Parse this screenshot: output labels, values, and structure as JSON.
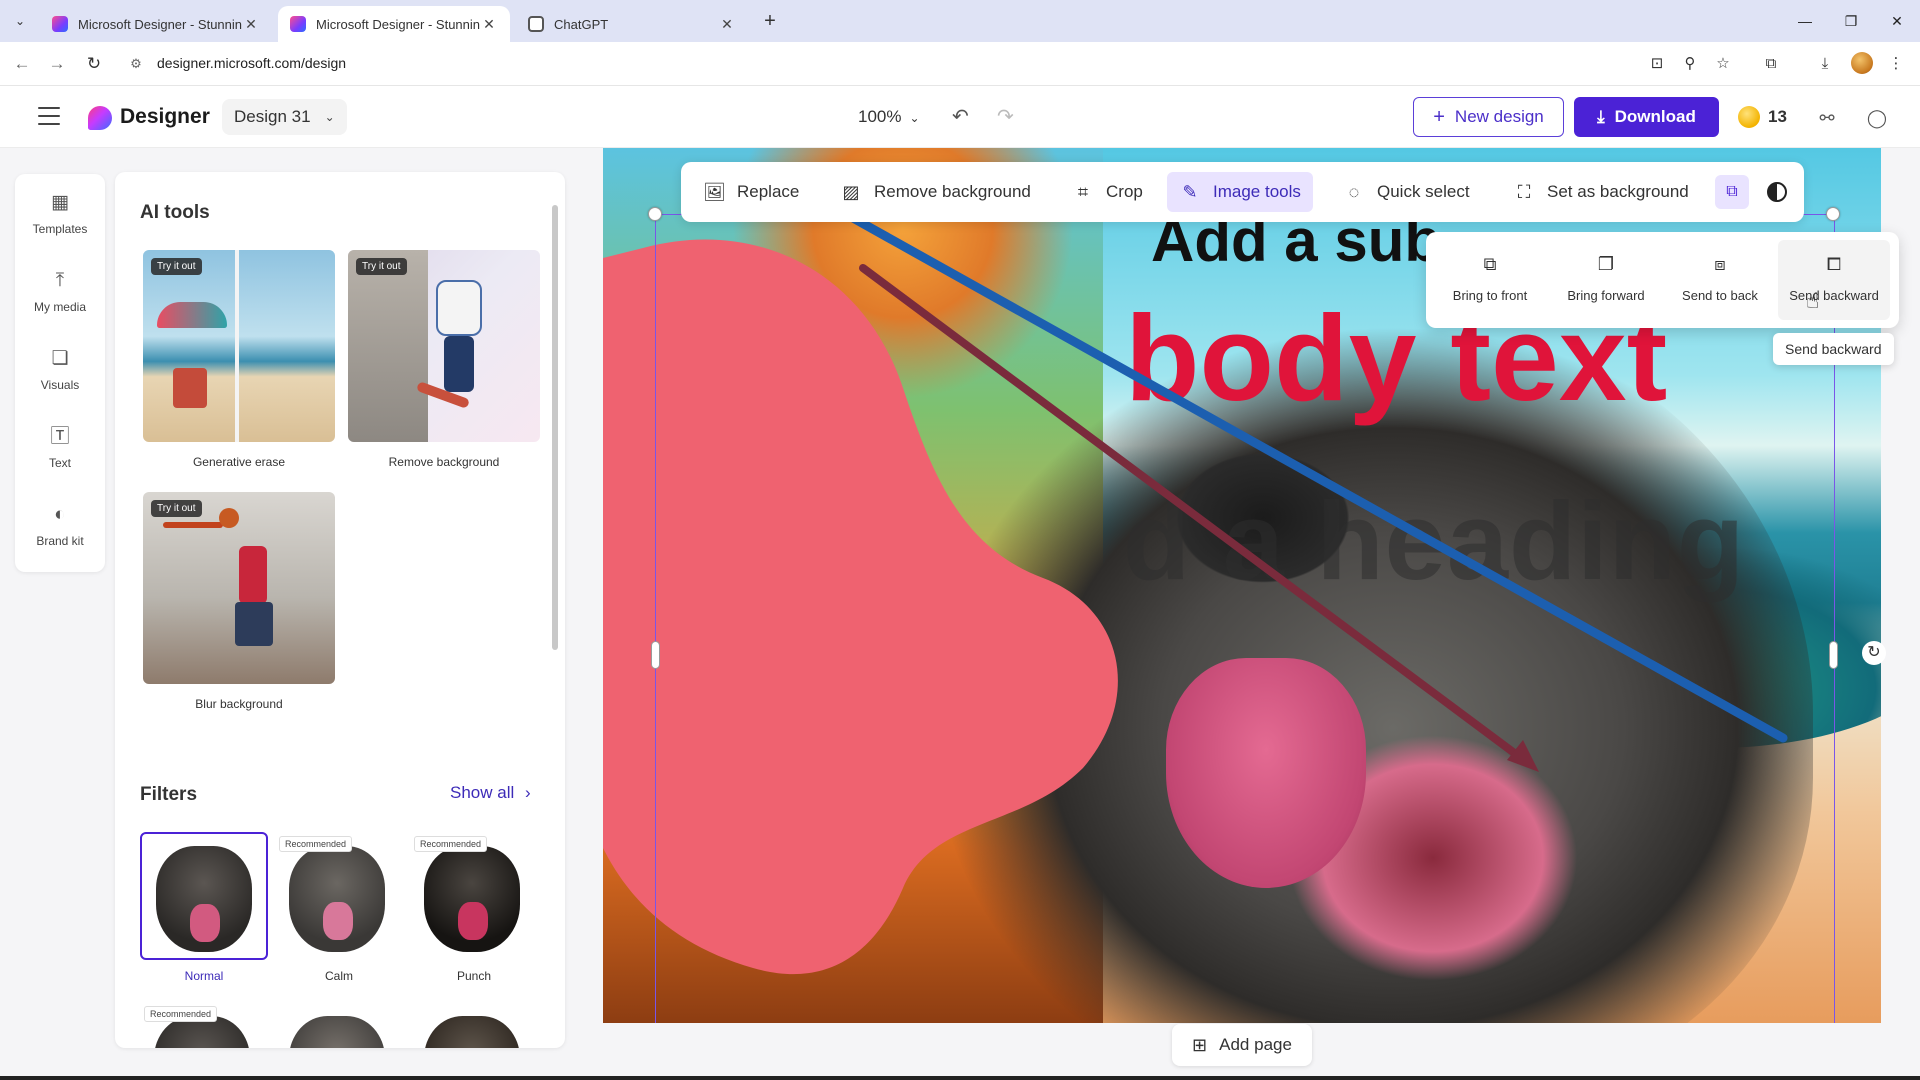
{
  "browser": {
    "tabs": [
      {
        "title": "Microsoft Designer - Stunning",
        "active": false,
        "favicon": "designer-icon"
      },
      {
        "title": "Microsoft Designer - Stunning",
        "active": true,
        "favicon": "designer-icon"
      },
      {
        "title": "ChatGPT",
        "active": false,
        "favicon": "chatgpt-icon"
      }
    ],
    "url": "designer.microsoft.com/design"
  },
  "app": {
    "brand": "Designer",
    "design_name": "Design 31",
    "zoom": "100%",
    "new_design_label": "New design",
    "download_label": "Download",
    "credits": "13",
    "accent_color": "#4b22d6"
  },
  "rail": [
    {
      "label": "Templates",
      "icon": "templates-icon"
    },
    {
      "label": "My media",
      "icon": "upload-icon"
    },
    {
      "label": "Visuals",
      "icon": "visuals-icon"
    },
    {
      "label": "Text",
      "icon": "text-icon"
    },
    {
      "label": "Brand kit",
      "icon": "palette-icon"
    }
  ],
  "panel": {
    "title": "AI tools",
    "tools": [
      {
        "label": "Generative erase",
        "badge": "Try it out"
      },
      {
        "label": "Remove background",
        "badge": "Try it out"
      },
      {
        "label": "Blur background",
        "badge": "Try it out"
      }
    ],
    "filters_title": "Filters",
    "show_all": "Show all",
    "filters": [
      {
        "label": "Normal",
        "selected": true,
        "badge": ""
      },
      {
        "label": "Calm",
        "selected": false,
        "badge": "Recommended"
      },
      {
        "label": "Punch",
        "selected": false,
        "badge": "Recommended"
      },
      {
        "label": "",
        "selected": false,
        "badge": "Recommended"
      },
      {
        "label": "",
        "selected": false,
        "badge": ""
      },
      {
        "label": "",
        "selected": false,
        "badge": ""
      }
    ]
  },
  "toolbar": {
    "replace": "Replace",
    "remove_bg": "Remove background",
    "crop": "Crop",
    "image_tools": "Image tools",
    "quick_select": "Quick select",
    "set_as_bg": "Set as background"
  },
  "arrange": {
    "bring_to_front": "Bring to front",
    "bring_forward": "Bring forward",
    "send_to_back": "Send to back",
    "send_backward": "Send backward",
    "tooltip": "Send backward"
  },
  "canvas": {
    "subheading": "Add a sub",
    "body_text": "body text",
    "heading": "d a heading",
    "blob_color": "#ef6270",
    "body_color": "#e0143a"
  },
  "add_page": "Add page"
}
